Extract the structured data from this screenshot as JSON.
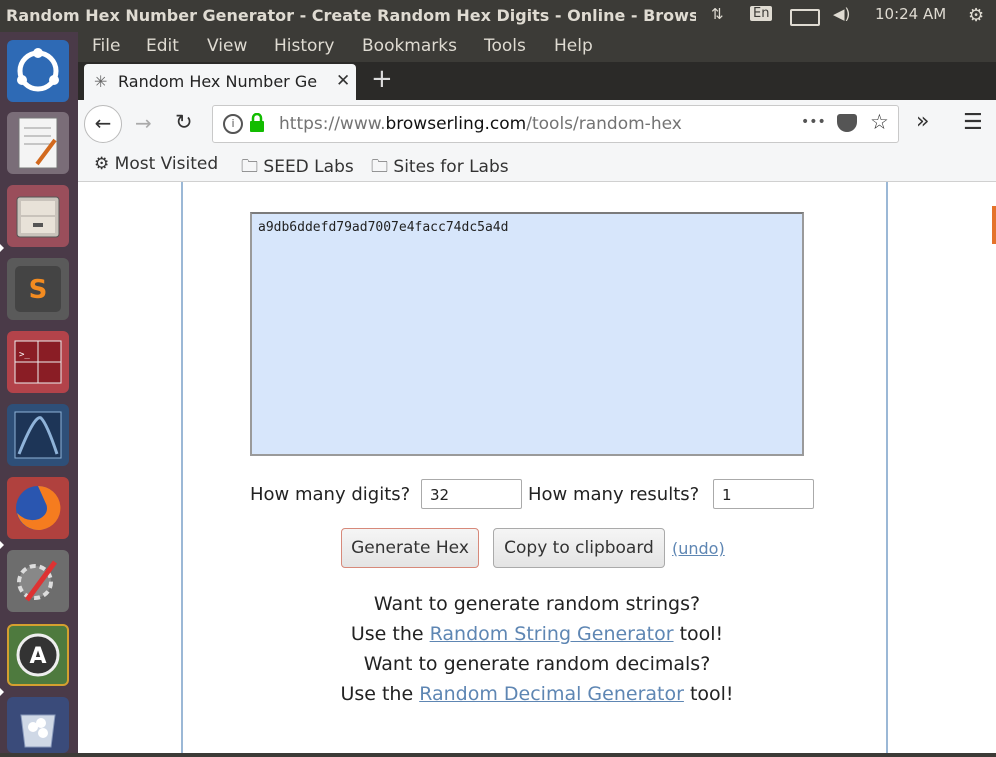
{
  "system_bar": {
    "window_title": "Random Hex Number Generator - Create Random Hex Digits - Online - Browse",
    "keyboard_layout": "En",
    "clock": "10:24 AM"
  },
  "launcher": {
    "items": [
      "ubuntu-dash",
      "text-editor",
      "file-manager",
      "sublime-text",
      "terminal",
      "wireshark",
      "firefox",
      "system-settings",
      "software-updater",
      "trash"
    ]
  },
  "menu": {
    "file": "File",
    "edit": "Edit",
    "view": "View",
    "history": "History",
    "bookmarks": "Bookmarks",
    "tools": "Tools",
    "help": "Help"
  },
  "tab": {
    "title": "Random Hex Number Ge",
    "new_tab": "+"
  },
  "navbar": {
    "url_prefix": "https://www.",
    "url_domain": "browserling.com",
    "url_path": "/tools/random-hex",
    "overflow": "»",
    "dots": "•••"
  },
  "bookmarks": {
    "most_visited": "Most Visited",
    "seed_labs": "SEED Labs",
    "sites_for_labs": "Sites for Labs"
  },
  "tool": {
    "output_value": "a9db6ddefd79ad7007e4facc74dc5a4d",
    "digits_label": "How many digits?",
    "digits_value": "32",
    "results_label": "How many results?",
    "results_value": "1",
    "generate_button": "Generate Hex",
    "copy_button": "Copy to clipboard",
    "undo_link": "(undo)"
  },
  "promo": {
    "line1": "Want to generate random strings?",
    "line2_prefix": "Use the ",
    "line2_link": "Random String Generator",
    "line2_suffix": " tool!",
    "line3": "Want to generate random decimals?",
    "line4_prefix": "Use the ",
    "line4_link": "Random Decimal Generator",
    "line4_suffix": " tool!"
  },
  "colors": {
    "output_bg": "#d7e6fb",
    "link": "#5e86b3",
    "lock_green": "#12bc00",
    "launcher_bg": "#4a3a48"
  }
}
